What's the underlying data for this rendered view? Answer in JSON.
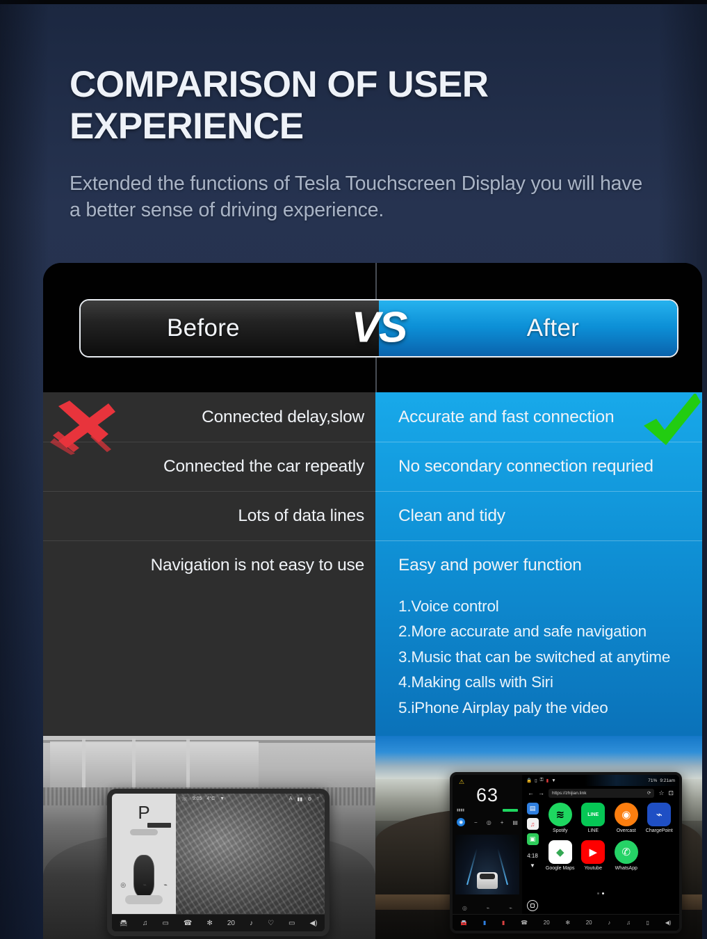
{
  "headline": "COMPARISON OF USER EXPERIENCE",
  "subhead": "Extended the functions of Tesla Touchscreen Display you will have a better sense of driving experience.",
  "comparison": {
    "before_label": "Before",
    "vs_label": "VS",
    "after_label": "After",
    "before_items": [
      "Connected delay,slow",
      "Connected the car repeatly",
      "Lots of data lines",
      "Navigation is not easy to use"
    ],
    "after_items": [
      "Accurate and fast connection",
      "No secondary connection requried",
      "Clean and tidy",
      "Easy and power function"
    ],
    "benefits": [
      "1.Voice control",
      "2.More accurate and safe navigation",
      "3.Music that can be switched at anytime",
      "4.Making calls with Siri",
      "5.iPhone Airplay paly the video"
    ],
    "x_icon": "red-cross-icon",
    "check_icon": "green-check-icon"
  },
  "colors": {
    "page_bg": "#232f4a",
    "accent_blue": "#18a9ea",
    "deep_blue": "#0a63ad",
    "panel_dark": "#2e2e2e",
    "cross_red": "#e83b3b",
    "check_green": "#22cc11",
    "headline_text": "#eef2f8",
    "subhead_text": "#a9b4c6"
  },
  "photo_before": {
    "gear_indicator": "P",
    "dock_icons": [
      "car-icon",
      "music-icon",
      "chat-icon",
      "phone-icon",
      "fan-icon",
      "temp-icon",
      "media-icon",
      "defrost-icon",
      "seat-icon",
      "volume-icon"
    ],
    "temperature": "20"
  },
  "photo_after": {
    "speed": "63",
    "time": "4:18",
    "url": "https://zhijian.link",
    "apps": [
      {
        "name": "Spotify",
        "icon": "spotify-icon",
        "color": "#1ed760"
      },
      {
        "name": "LINE",
        "icon": "line-icon",
        "color": "#06c755"
      },
      {
        "name": "Overcast",
        "icon": "overcast-icon",
        "color": "#fc7e0f"
      },
      {
        "name": "ChargePoint",
        "icon": "chargepoint-icon",
        "color": "#1f4fc4"
      },
      {
        "name": "Google Maps",
        "icon": "google-maps-icon",
        "color": "#ffffff"
      },
      {
        "name": "Youtube",
        "icon": "youtube-icon",
        "color": "#ff0000"
      },
      {
        "name": "WhatsApp",
        "icon": "whatsapp-icon",
        "color": "#25d366"
      }
    ],
    "sidebar_icons": [
      "carplay-icon",
      "music-icon",
      "messages-icon"
    ],
    "temp_left": "20",
    "temp_right": "20",
    "dock_icons": [
      "car-icon",
      "seat-heat-blue-icon",
      "seat-heat-red-icon",
      "phone-icon",
      "fan-icon",
      "music-icon",
      "volume-icon"
    ]
  }
}
